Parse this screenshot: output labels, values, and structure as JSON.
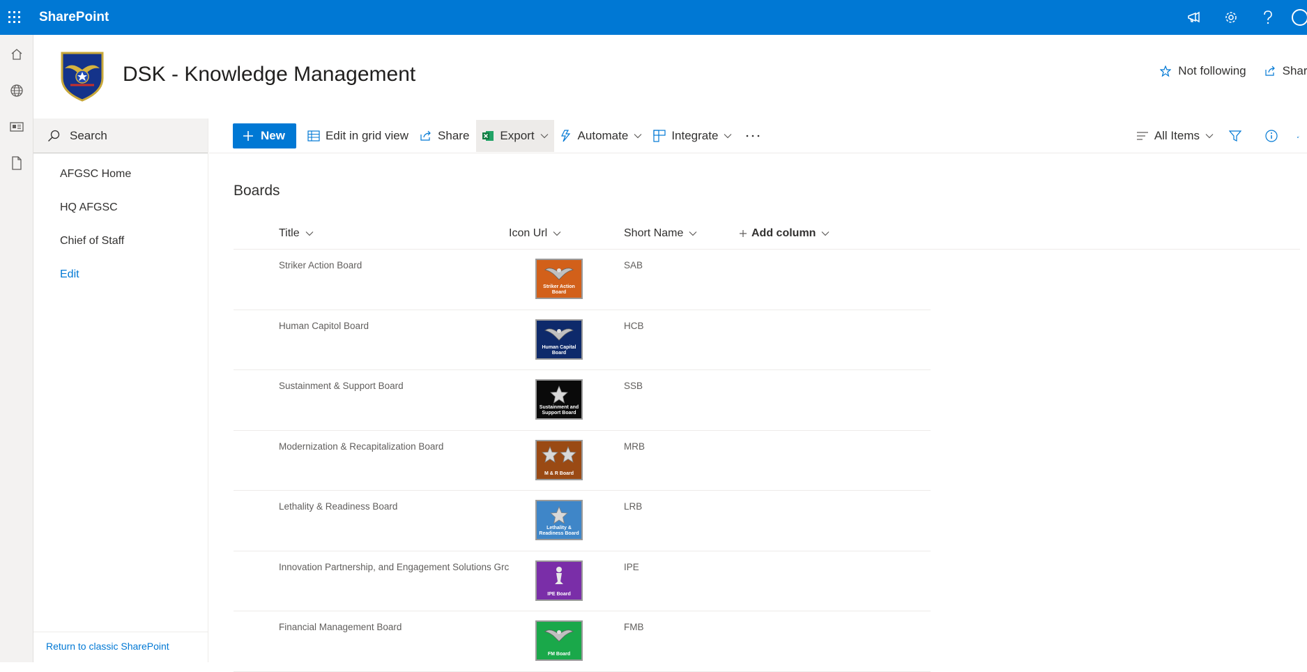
{
  "suite": {
    "brand": "SharePoint"
  },
  "site": {
    "title": "DSK - Knowledge Management",
    "follow_label": "Not following",
    "share_label": "Share"
  },
  "leftnav": {
    "search_label": "Search",
    "links": [
      "AFGSC Home",
      "HQ AFGSC",
      "Chief of Staff"
    ],
    "edit_label": "Edit",
    "footer_label": "Return to classic SharePoint"
  },
  "commandbar": {
    "new_label": "New",
    "grid_label": "Edit in grid view",
    "share_label": "Share",
    "export_label": "Export",
    "automate_label": "Automate",
    "integrate_label": "Integrate",
    "view_label": "All Items"
  },
  "list": {
    "title": "Boards",
    "columns": [
      "Title",
      "Icon Url",
      "Short Name"
    ],
    "add_column_label": "Add column",
    "rows": [
      {
        "title": "Striker Action Board",
        "short": "SAB",
        "icon_color": "#d2601a",
        "icon_caption": "Striker Action Board",
        "emblem": "eagle"
      },
      {
        "title": "Human Capitol Board",
        "short": "HCB",
        "icon_color": "#0e2a6b",
        "icon_caption": "Human Capital Board",
        "emblem": "eagle"
      },
      {
        "title": "Sustainment & Support Board",
        "short": "SSB",
        "icon_color": "#0a0a0a",
        "icon_caption": "Sustainment and Support Board",
        "emblem": "star"
      },
      {
        "title": "Modernization & Recapitalization Board",
        "short": "MRB",
        "icon_color": "#9a4a14",
        "icon_caption": "M & R Board",
        "emblem": "twostar"
      },
      {
        "title": "Lethality & Readiness Board",
        "short": "LRB",
        "icon_color": "#3f86c8",
        "icon_caption": "Lethality & Readiness Board",
        "emblem": "star"
      },
      {
        "title": "Innovation Partnership, and Engagement Solutions Grc",
        "short": "IPE",
        "icon_color": "#7a2ea8",
        "icon_caption": "IPE Board",
        "emblem": "pawn"
      },
      {
        "title": "Financial Management Board",
        "short": "FMB",
        "icon_color": "#1aa84a",
        "icon_caption": "FM Board",
        "emblem": "eagle"
      }
    ]
  }
}
